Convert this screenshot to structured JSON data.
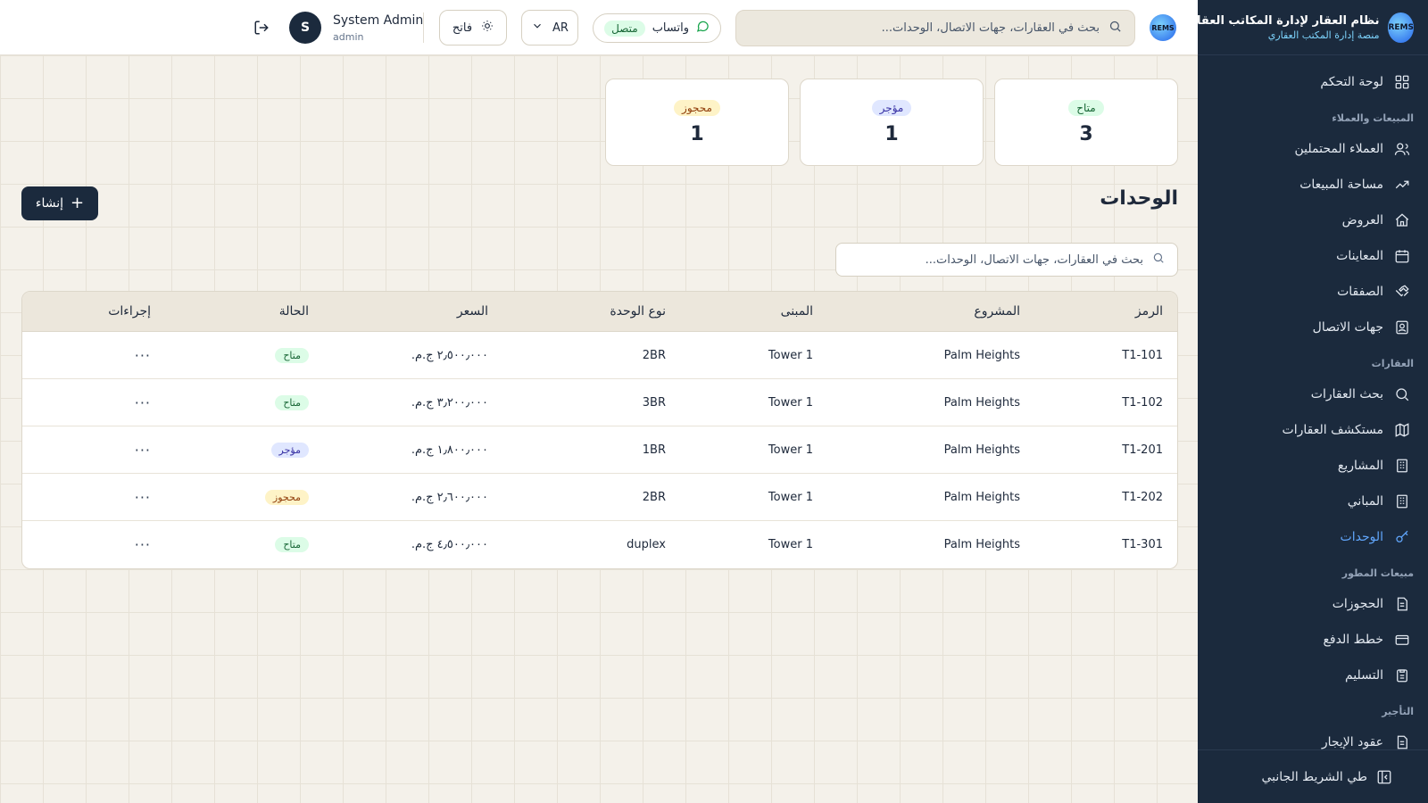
{
  "sidebar": {
    "brand_title": "نظام العقار لإدارة المكاتب العقارية",
    "brand_sub": "منصة إدارة المكتب العقاري",
    "brand_logo": "REMS",
    "items": [
      {
        "label": "لوحة التحكم",
        "icon": "grid-icon"
      },
      {
        "section": "المبيعات والعملاء"
      },
      {
        "label": "العملاء المحتملين",
        "icon": "users-icon"
      },
      {
        "label": "مساحة المبيعات",
        "icon": "trending-icon"
      },
      {
        "label": "العروض",
        "icon": "home-icon"
      },
      {
        "label": "المعاينات",
        "icon": "calendar-icon"
      },
      {
        "label": "الصفقات",
        "icon": "handshake-icon"
      },
      {
        "label": "جهات الاتصال",
        "icon": "contact-icon"
      },
      {
        "section": "العقارات"
      },
      {
        "label": "بحث العقارات",
        "icon": "search-icon"
      },
      {
        "label": "مستكشف العقارات",
        "icon": "map-icon"
      },
      {
        "label": "المشاريع",
        "icon": "building-icon"
      },
      {
        "label": "المباني",
        "icon": "building-icon"
      },
      {
        "label": "الوحدات",
        "icon": "key-icon",
        "active": true
      },
      {
        "section": "مبيعات المطور"
      },
      {
        "label": "الحجوزات",
        "icon": "doc-icon"
      },
      {
        "label": "خطط الدفع",
        "icon": "card-icon"
      },
      {
        "label": "التسليم",
        "icon": "clipboard-icon"
      },
      {
        "section": "التأجير"
      },
      {
        "label": "عقود الإيجار",
        "icon": "doc-icon"
      }
    ],
    "collapse_label": "طي الشريط الجانبي"
  },
  "topbar": {
    "logo": "REMS",
    "search_placeholder": "بحث في العقارات، جهات الاتصال، الوحدات...",
    "whatsapp_label": "واتساب",
    "whatsapp_status": "متصل",
    "lang": "AR",
    "theme": "فاتح",
    "user_initial": "S",
    "user_name": "System Admin",
    "user_role": "admin"
  },
  "stats": [
    {
      "label": "متاح",
      "value": "3"
    },
    {
      "label": "مؤجر",
      "value": "1"
    },
    {
      "label": "محجوز",
      "value": "1"
    }
  ],
  "page": {
    "title": "الوحدات",
    "create_label": "إنشاء",
    "search_placeholder": "بحث في العقارات، جهات الاتصال، الوحدات..."
  },
  "table": {
    "headers": {
      "code": "الرمز",
      "project": "المشروع",
      "building": "المبنى",
      "type": "نوع الوحدة",
      "price": "السعر",
      "status": "الحالة",
      "actions": "إجراءات"
    },
    "rows": [
      {
        "code": "T1-101",
        "project": "Palm Heights",
        "building": "Tower 1",
        "type": "2BR",
        "price": "٢٫٥٠٠٫٠٠٠ ج.م.",
        "status": "متاح",
        "actions": "···"
      },
      {
        "code": "T1-102",
        "project": "Palm Heights",
        "building": "Tower 1",
        "type": "3BR",
        "price": "٣٫٢٠٠٫٠٠٠ ج.م.",
        "status": "متاح",
        "actions": "···"
      },
      {
        "code": "T1-201",
        "project": "Palm Heights",
        "building": "Tower 1",
        "type": "1BR",
        "price": "١٫٨٠٠٫٠٠٠ ج.م.",
        "status": "مؤجر",
        "actions": "···"
      },
      {
        "code": "T1-202",
        "project": "Palm Heights",
        "building": "Tower 1",
        "type": "2BR",
        "price": "٢٫٦٠٠٫٠٠٠ ج.م.",
        "status": "محجوز",
        "actions": "···"
      },
      {
        "code": "T1-301",
        "project": "Palm Heights",
        "building": "Tower 1",
        "type": "duplex",
        "price": "٤٫٥٠٠٫٠٠٠ ج.م.",
        "status": "متاح",
        "actions": "···"
      }
    ]
  },
  "colors": {
    "sidebar_bg": "#1b2a3d",
    "accent": "#60a5fa",
    "available": "#dcfce7",
    "rented": "#e0e7ff",
    "reserved": "#fef3c7"
  }
}
